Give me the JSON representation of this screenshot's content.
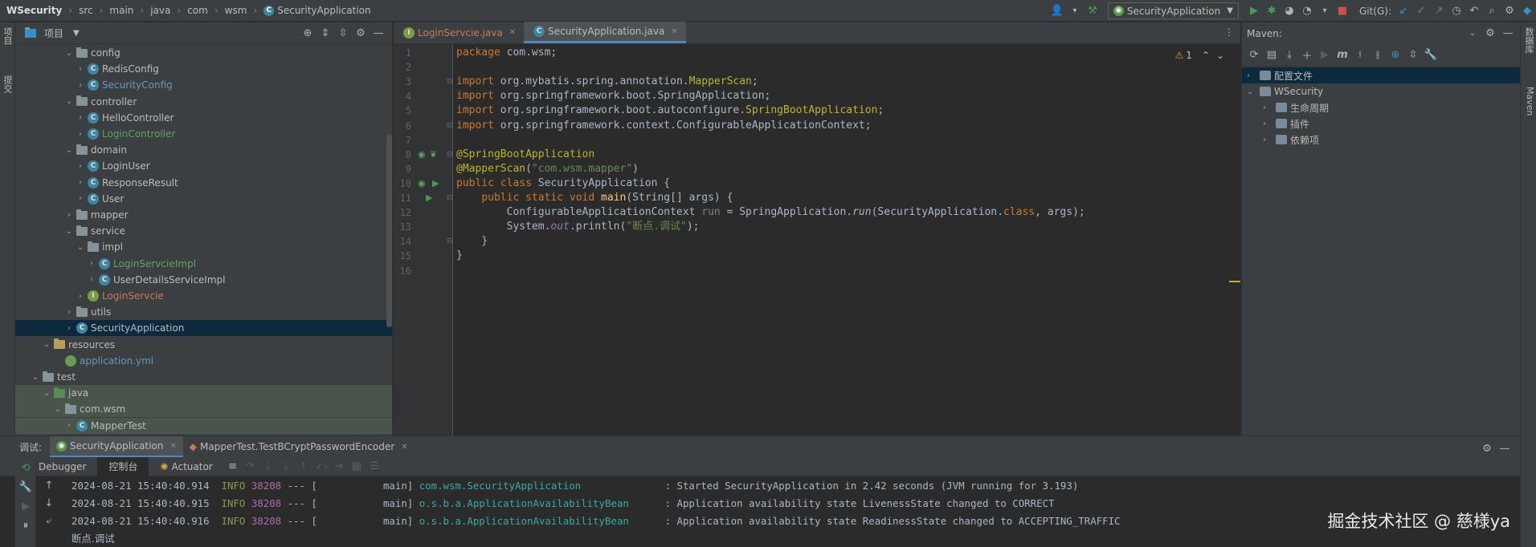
{
  "breadcrumb": [
    "WSecurity",
    "src",
    "main",
    "java",
    "com",
    "wsm",
    "SecurityApplication"
  ],
  "toolbar": {
    "run_config": "SecurityApplication",
    "git_label": "Git(G):"
  },
  "left_strip": {
    "tab_project": "项目",
    "tab_commit": "提交"
  },
  "project_panel": {
    "title": "项目",
    "tree": [
      {
        "label": "config",
        "kind": "folder",
        "color": "default",
        "expanded": true
      },
      {
        "label": "RedisConfig",
        "kind": "class",
        "color": "default"
      },
      {
        "label": "SecurityConfig",
        "kind": "class",
        "color": "blue"
      },
      {
        "label": "controller",
        "kind": "folder",
        "color": "default",
        "expanded": true
      },
      {
        "label": "HelloController",
        "kind": "class",
        "color": "default"
      },
      {
        "label": "LoginController",
        "kind": "class",
        "color": "green"
      },
      {
        "label": "domain",
        "kind": "folder",
        "color": "default",
        "expanded": true
      },
      {
        "label": "LoginUser",
        "kind": "class",
        "color": "default"
      },
      {
        "label": "ResponseResult",
        "kind": "class",
        "color": "default"
      },
      {
        "label": "User",
        "kind": "class",
        "color": "default"
      },
      {
        "label": "mapper",
        "kind": "folder",
        "color": "default",
        "expanded": false
      },
      {
        "label": "service",
        "kind": "folder",
        "color": "default",
        "expanded": true
      },
      {
        "label": "impl",
        "kind": "folder",
        "color": "default",
        "expanded": true
      },
      {
        "label": "LoginServcieImpl",
        "kind": "class",
        "color": "green"
      },
      {
        "label": "UserDetailsServiceImpl",
        "kind": "class",
        "color": "default"
      },
      {
        "label": "LoginServcie",
        "kind": "interface",
        "color": "red"
      },
      {
        "label": "utils",
        "kind": "folder",
        "color": "default",
        "expanded": false
      },
      {
        "label": "SecurityApplication",
        "kind": "class",
        "color": "default",
        "selected": true
      },
      {
        "label": "resources",
        "kind": "res-folder",
        "color": "default",
        "expanded": true
      },
      {
        "label": "application.yml",
        "kind": "yml",
        "color": "blue"
      },
      {
        "label": "test",
        "kind": "folder",
        "color": "default",
        "expanded": true
      },
      {
        "label": "java",
        "kind": "java-test-folder",
        "color": "default",
        "expanded": true,
        "test": true
      },
      {
        "label": "com.wsm",
        "kind": "folder",
        "color": "default",
        "expanded": true,
        "test": true
      },
      {
        "label": "MapperTest",
        "kind": "class",
        "color": "default",
        "test": true
      }
    ]
  },
  "editor": {
    "tabs": [
      {
        "label": "LoginServcie.java",
        "color": "red",
        "active": false
      },
      {
        "label": "SecurityApplication.java",
        "color": "default",
        "active": true
      }
    ],
    "warnings_count": "1",
    "line_numbers": [
      "1",
      "2",
      "3",
      "4",
      "5",
      "6",
      "7",
      "8",
      "9",
      "10",
      "11",
      "12",
      "13",
      "14",
      "15",
      "16"
    ],
    "code": {
      "l1_kw": "package",
      "l1_rest": " com.wsm;",
      "l3_kw": "import",
      "l3_a": " org.mybatis.spring.annotation.",
      "l3_b": "MapperScan",
      "l3_c": ";",
      "l4_kw": "import",
      "l4_a": " org.springframework.boot.SpringApplication;",
      "l5_kw": "import",
      "l5_a": " org.springframework.boot.autoconfigure.",
      "l5_b": "SpringBootApplication",
      "l5_c": ";",
      "l6_kw": "import",
      "l6_a": " org.springframework.context.ConfigurableApplicationContext;",
      "l8_ann": "@SpringBootApplication",
      "l9_ann": "@MapperScan",
      "l9_p1": "(",
      "l9_str": "\"com.wsm.mapper\"",
      "l9_p2": ")",
      "l10_kw": "public class",
      "l10_rest": " SecurityApplication {",
      "l11_indent": "    ",
      "l11_kw": "public static void",
      "l11_sp": " ",
      "l11_fn": "main",
      "l11_rest": "(String[] args) {",
      "l12_a": "        ConfigurableApplicationContext ",
      "l12_var": "run",
      "l12_b": " = SpringApplication.",
      "l12_it": "run",
      "l12_c": "(SecurityApplication.",
      "l12_kw": "class",
      "l12_d": ", args);",
      "l13_a": "        System.",
      "l13_out": "out",
      "l13_b": ".println(",
      "l13_str": "\"断点.调试\"",
      "l13_c": ");",
      "l14": "    }",
      "l15": "}"
    }
  },
  "maven": {
    "title": "Maven:",
    "tree": [
      {
        "label": "配置文件",
        "depth": 0,
        "selected": true
      },
      {
        "label": "WSecurity",
        "depth": 0,
        "expanded": true
      },
      {
        "label": "生命周期",
        "depth": 1
      },
      {
        "label": "插件",
        "depth": 1
      },
      {
        "label": "依赖项",
        "depth": 1
      }
    ]
  },
  "right_strip": {
    "tab_db": "数据库",
    "tab_maven": "Maven"
  },
  "debug": {
    "label": "调试:",
    "tabs": [
      {
        "label": "SecurityApplication",
        "active": true
      },
      {
        "label": "MapperTest.TestBCryptPasswordEncoder",
        "active": false
      }
    ],
    "subtabs": [
      "Debugger",
      "控制台",
      "Actuator"
    ],
    "console": [
      {
        "ts": "2024-08-21 15:40:40.914",
        "level": "INFO",
        "pid": "38208",
        "mid": " --- [           main] ",
        "logger": "com.wsm.SecurityApplication             ",
        "msg": " : Started SecurityApplication in 2.42 seconds (JVM running for 3.193)"
      },
      {
        "ts": "2024-08-21 15:40:40.915",
        "level": "INFO",
        "pid": "38208",
        "mid": " --- [           main] ",
        "logger": "o.s.b.a.ApplicationAvailabilityBean     ",
        "msg": " : Application availability state LivenessState changed to CORRECT"
      },
      {
        "ts": "2024-08-21 15:40:40.916",
        "level": "INFO",
        "pid": "38208",
        "mid": " --- [           main] ",
        "logger": "o.s.b.a.ApplicationAvailabilityBean     ",
        "msg": " : Application availability state ReadinessState changed to ACCEPTING_TRAFFIC"
      }
    ],
    "output_line": "断点.调试"
  },
  "watermark": "掘金技术社区 @ 慈様ya"
}
